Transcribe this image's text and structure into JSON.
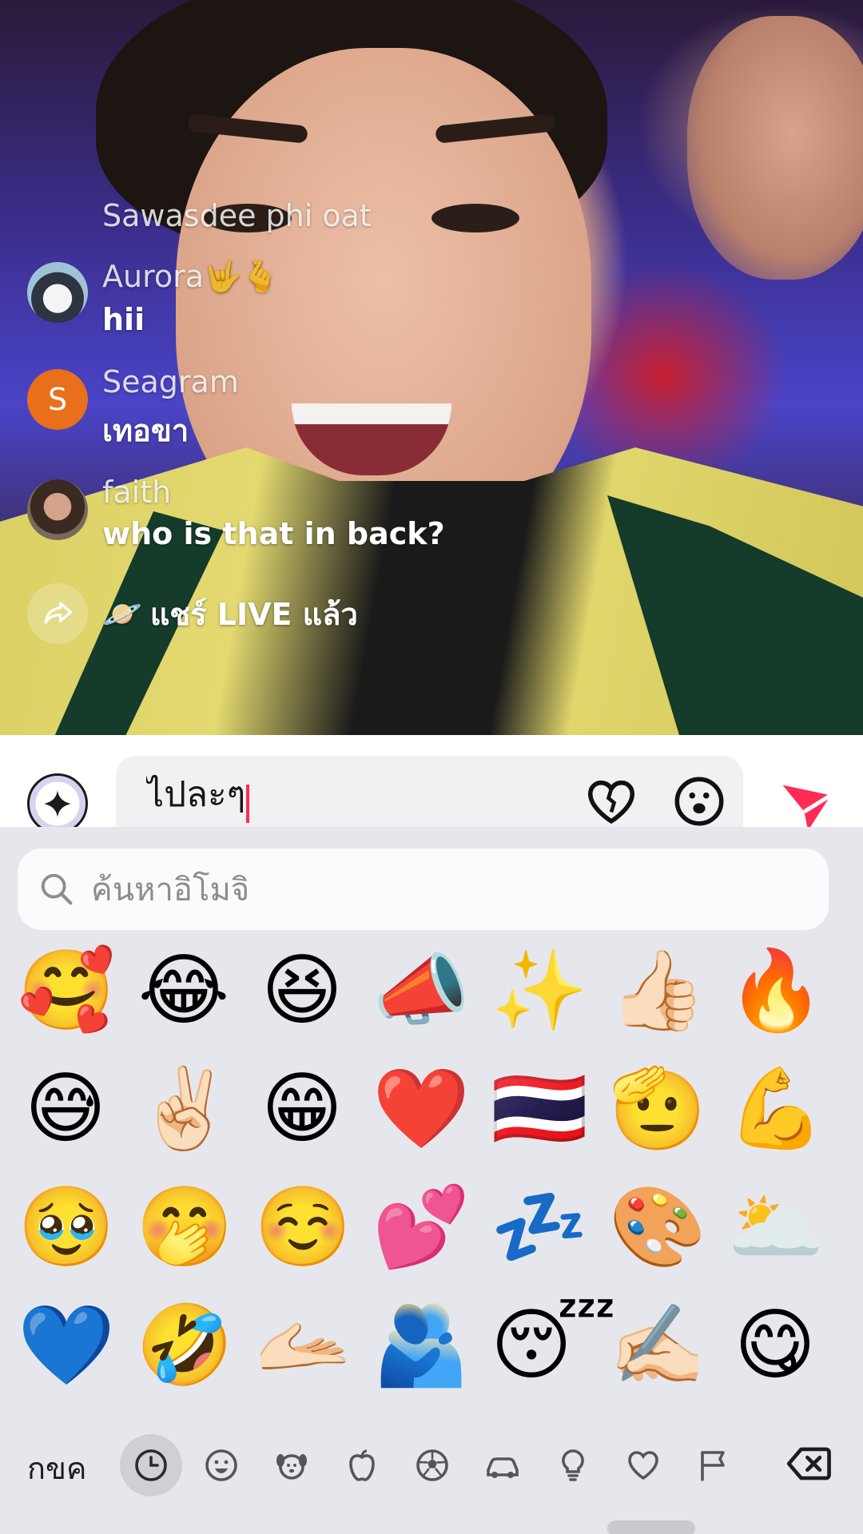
{
  "live": {
    "chat": [
      {
        "user": "Sawasdee phi oat",
        "message": "",
        "avatar": "none"
      },
      {
        "user": "Aurora🤟🫰",
        "message": "hii",
        "avatar": "penguin"
      },
      {
        "user": "Seagram",
        "message": "เทอขา",
        "avatar": "letter",
        "avatar_letter": "S",
        "avatar_color": "#e8701a"
      },
      {
        "user": "faith",
        "message": "who is that in back?",
        "avatar": "photo"
      }
    ],
    "share_event": {
      "emoji": "🪐",
      "text": "แชร์ LIVE แล้ว",
      "icon": "share-arrow-icon"
    }
  },
  "comment_bar": {
    "input_value": "ไปละๆ",
    "icons": [
      "sparkle-icon",
      "heart-icon",
      "emoji-face-icon",
      "send-icon"
    ],
    "accent_color": "#fe2c55"
  },
  "emoji_keyboard": {
    "search_placeholder": "ค้นหาอิโมจิ",
    "emojis": [
      [
        "🥰",
        "😂",
        "😆",
        "📣",
        "✨",
        "👍🏻",
        "🔥"
      ],
      [
        "😅",
        "✌🏻",
        "😁",
        "❤️",
        "🇹🇭",
        "🫡",
        "💪"
      ],
      [
        "🥹",
        "🤭",
        "☺️",
        "💕",
        "💤",
        "🎨",
        "🌥️"
      ],
      [
        "💙",
        "🤣",
        "🫴🏻",
        "🫂",
        "😴",
        "✍🏻",
        "😋"
      ]
    ],
    "abc_label": "กขค",
    "categories": [
      "recent",
      "smileys",
      "animals",
      "food",
      "activity",
      "travel",
      "objects",
      "symbols",
      "flags"
    ],
    "active_category": "recent"
  }
}
